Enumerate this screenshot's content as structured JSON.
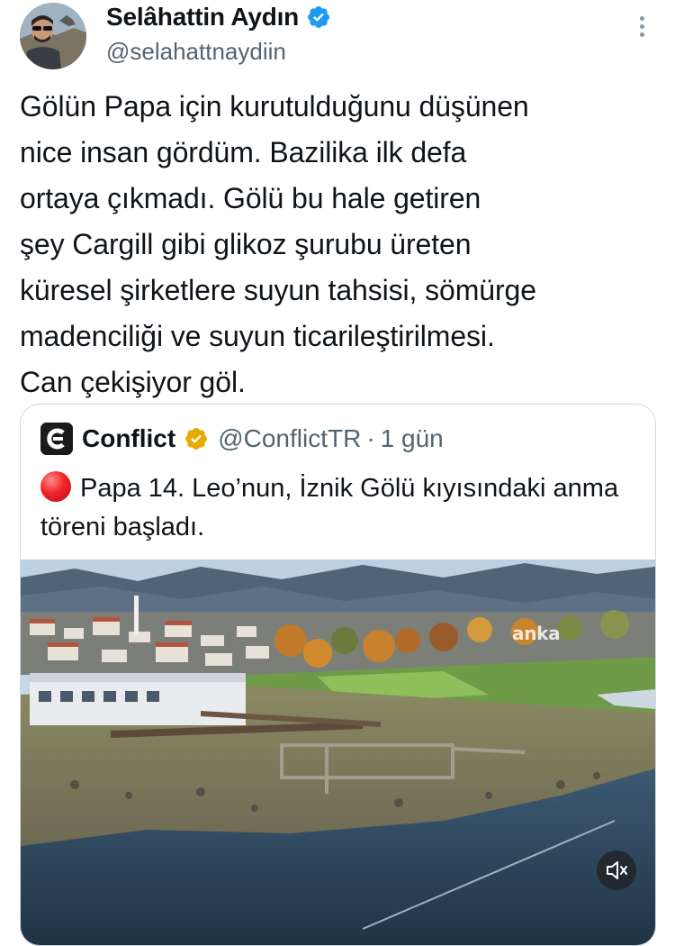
{
  "author": {
    "display_name": "Selâhattin Aydın",
    "handle": "@selahattnaydiin",
    "verified": true,
    "badge_color": "#1d9bf0"
  },
  "tweet": {
    "text": "Gölün Papa için kurutulduğunu düşünen\nnice insan gördüm. Bazilika ilk defa\nortaya çıkmadı. Gölü bu hale getiren\nşey Cargill gibi glikoz şurubu üreten\nküresel şirketlere suyun tahsisi, sömürge\nmadenciliği ve suyun ticarileştirilmesi.\nCan çekişiyor göl."
  },
  "quote": {
    "display_name": "Conflict",
    "handle": "@ConflictTR",
    "separator": "·",
    "time": "1 gün",
    "badge_color": "#e8a900",
    "text": "Papa 14. Leo’nun, İznik Gölü kıyısındaki anma töreni başladı.",
    "media": {
      "watermark": "anka",
      "mute_icon": "speaker-muted-icon"
    }
  },
  "icons": {
    "more": "more-vertical-icon",
    "verified": "verified-badge-icon",
    "logo": "conflict-logo-icon",
    "live_dot": "red-circle-emoji"
  }
}
